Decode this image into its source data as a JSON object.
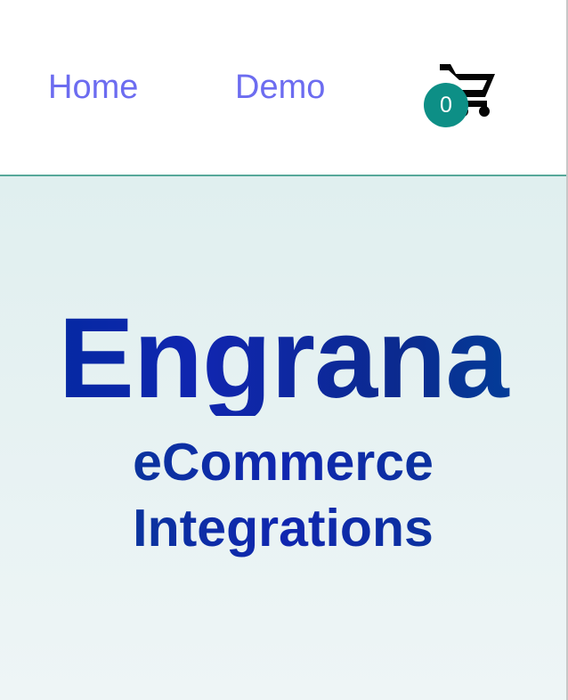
{
  "nav": {
    "home_label": "Home",
    "demo_label": "Demo"
  },
  "cart": {
    "icon": "shopping-cart-icon",
    "count": "0"
  },
  "hero": {
    "title": "Engrana",
    "subtitle_line1": "eCommerce",
    "subtitle_line2": "Integrations"
  },
  "colors": {
    "nav_link": "#6c6cf0",
    "badge": "#0d8f86",
    "hero_bg_top": "#e0efef",
    "hero_bg_bottom": "#eef5f6",
    "hero_text": "#07239a",
    "divider": "#57a89a"
  }
}
